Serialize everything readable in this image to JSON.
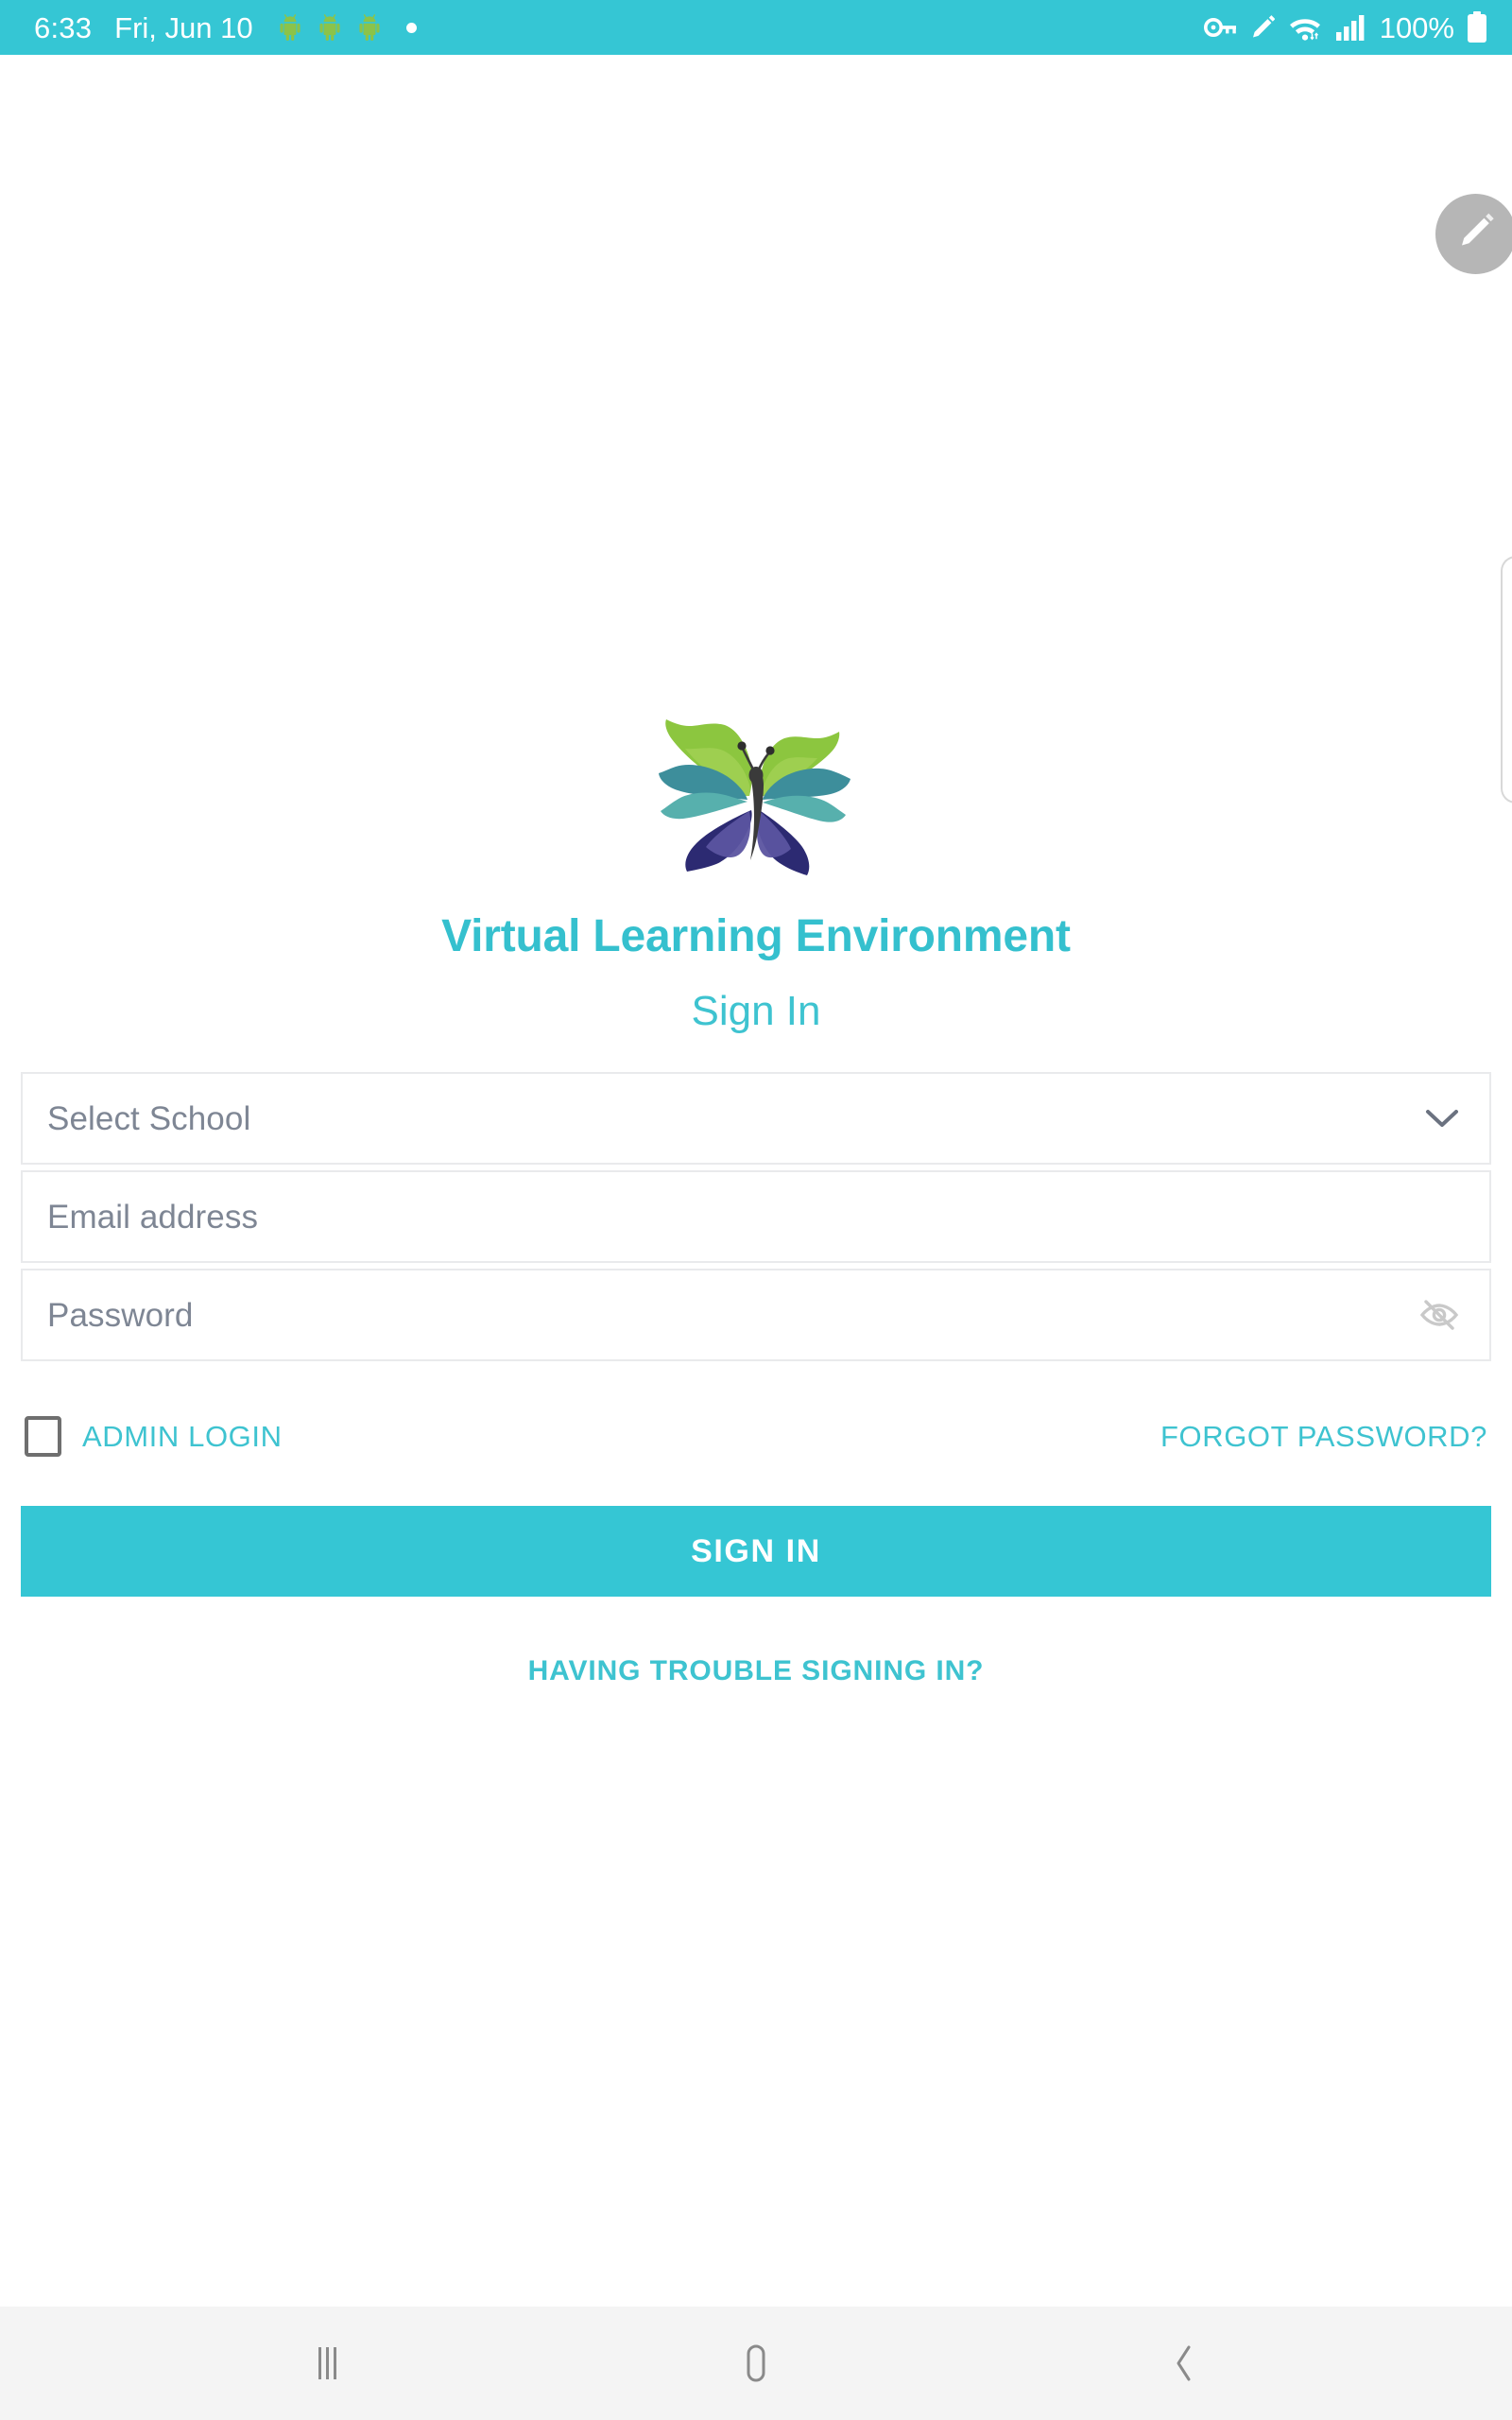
{
  "status_bar": {
    "time": "6:33",
    "date": "Fri, Jun 10",
    "battery_percent": "100%",
    "background_color": "#35c6d4",
    "notification_icons": [
      "android-icon",
      "android-icon",
      "android-icon",
      "dot-icon"
    ],
    "right_icons": [
      "vpn-key-icon",
      "stylus-icon",
      "wifi-icon",
      "signal-bars-icon",
      "battery-icon"
    ]
  },
  "overlay": {
    "edit_fab_icon": "pencil-icon",
    "edge_panel_handle": "edge-panel-handle"
  },
  "branding": {
    "logo_icon": "butterfly-logo",
    "app_title": "Virtual Learning Environment",
    "title_color": "#35c0ce"
  },
  "form": {
    "heading": "Sign In",
    "school_select": {
      "placeholder": "Select School",
      "value": "",
      "icon": "chevron-down-icon"
    },
    "email": {
      "placeholder": "Email address",
      "value": ""
    },
    "password": {
      "placeholder": "Password",
      "value": "",
      "visibility_icon": "eye-off-icon"
    },
    "admin_login": {
      "label": "ADMIN LOGIN",
      "checked": false
    },
    "forgot_password_label": "FORGOT PASSWORD?",
    "submit_label": "SIGN IN",
    "submit_color": "#35c6d4",
    "trouble_label": "HAVING TROUBLE SIGNING IN?",
    "accent_color": "#3ec3d0"
  },
  "nav_bar": {
    "recents_icon": "recents-icon",
    "home_icon": "home-icon",
    "back_icon": "back-icon",
    "background_color": "#f4f4f4"
  }
}
